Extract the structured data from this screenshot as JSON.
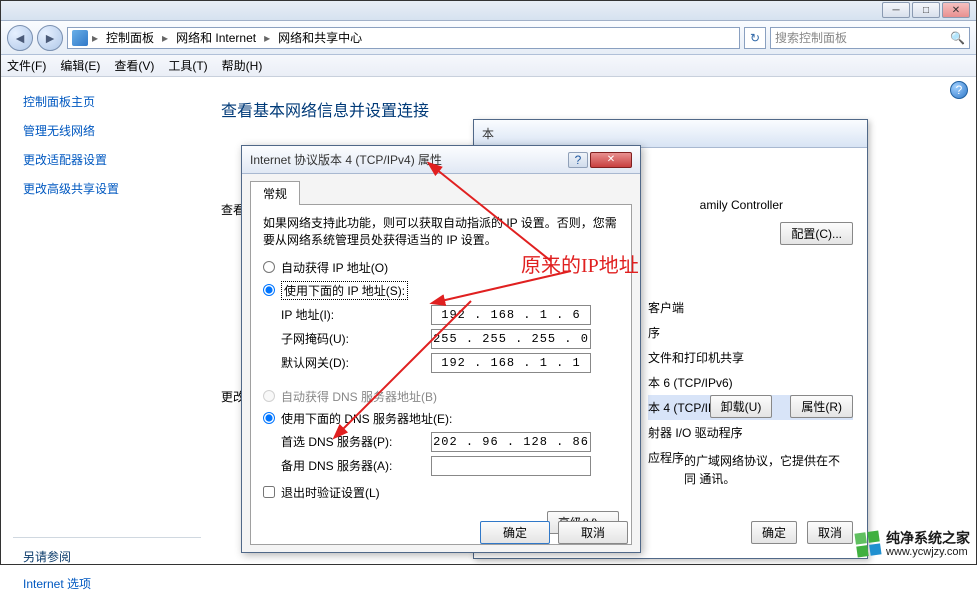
{
  "window": {
    "minimize": "─",
    "maximize": "□",
    "close": "✕"
  },
  "nav": {
    "back": "◄",
    "fwd": "►",
    "crumbs": [
      "控制面板",
      "网络和 Internet",
      "网络和共享中心"
    ],
    "refresh": "↻",
    "search_placeholder": "搜索控制面板"
  },
  "menu": {
    "file": "文件(F)",
    "edit": "编辑(E)",
    "view": "查看(V)",
    "tools": "工具(T)",
    "help": "帮助(H)"
  },
  "sidebar": {
    "links": [
      "控制面板主页",
      "管理无线网络",
      "更改适配器设置",
      "更改高级共享设置"
    ],
    "see_also": "另请参阅",
    "bottom": "Internet 选项"
  },
  "main": {
    "title": "查看基本网络信息并设置连接",
    "cut1": "查看",
    "cut2": "更改"
  },
  "backdlg": {
    "title_prefix": "本",
    "controller": "amily Controller",
    "configure": "配置(C)...",
    "items": [
      "客户端",
      "序",
      "文件和打印机共享",
      "本 6 (TCP/IPv6)",
      "本 4 (TCP/IPv4)",
      "射器 I/O 驱动程序",
      "应程序"
    ],
    "uninstall": "卸载(U)",
    "properties": "属性(R)",
    "desc": "的广域网络协议，它提供在不同\n通讯。",
    "ok": "确定",
    "cancel": "取消"
  },
  "ipdlg": {
    "title": "Internet 协议版本 4 (TCP/IPv4) 属性",
    "tab": "常规",
    "info": "如果网络支持此功能，则可以获取自动指派的 IP 设置。否则，您需要从网络系统管理员处获得适当的 IP 设置。",
    "auto_ip": "自动获得 IP 地址(O)",
    "use_ip": "使用下面的 IP 地址(S):",
    "ip_label": "IP 地址(I):",
    "ip_value": "192 . 168 .  1  .  6",
    "mask_label": "子网掩码(U):",
    "mask_value": "255 . 255 . 255 .  0",
    "gw_label": "默认网关(D):",
    "gw_value": "192 . 168 .  1  .  1",
    "auto_dns": "自动获得 DNS 服务器地址(B)",
    "use_dns": "使用下面的 DNS 服务器地址(E):",
    "dns1_label": "首选 DNS 服务器(P):",
    "dns1_value": "202 . 96 . 128 . 86",
    "dns2_label": "备用 DNS 服务器(A):",
    "dns2_value": "",
    "validate": "退出时验证设置(L)",
    "advanced": "高级(V)...",
    "ok": "确定",
    "cancel": "取消"
  },
  "annotation": "原来的IP地址",
  "watermark": {
    "brand": "纯净系统之家",
    "url": "www.ycwjzy.com"
  }
}
